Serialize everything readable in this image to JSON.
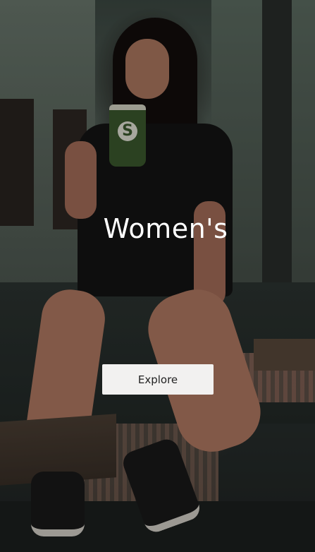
{
  "hero": {
    "title": "Women's",
    "explore_label": "Explore"
  },
  "colors": {
    "title_text": "#ffffff",
    "button_background": "#f2f1f0",
    "button_text": "#222222"
  }
}
